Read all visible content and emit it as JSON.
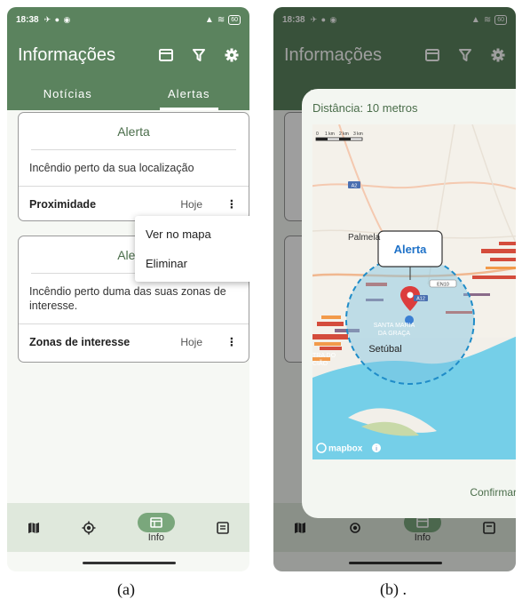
{
  "status": {
    "time": "18:38",
    "battery": "60"
  },
  "app": {
    "title": "Informações",
    "tabs": [
      "Notícias",
      "Alertas"
    ]
  },
  "alerts": [
    {
      "title": "Alerta",
      "body": "Incêndio perto da sua localização",
      "type": "Proximidade",
      "date": "Hoje"
    },
    {
      "title": "Alerta",
      "body": "Incêndio perto duma das suas zonas de interesse.",
      "type": "Zonas de interesse",
      "date": "Hoje"
    }
  ],
  "context_menu": [
    "Ver no mapa",
    "Eliminar"
  ],
  "nav": {
    "info_label": "Info"
  },
  "dialog": {
    "distance": "Distância: 10 metros",
    "confirm": "Confirmar",
    "map": {
      "callout": "Alerta",
      "scale_labels": [
        "0",
        "1 km",
        "2 km",
        "3 km"
      ],
      "road_labels": [
        "A2",
        "EN10",
        "A12"
      ],
      "places": [
        "Palmela",
        "SANTA MARIA",
        "DA GRAÇA",
        "Setúbal",
        "TRA DO",
        "CIÃO"
      ],
      "attribution": "mapbox"
    }
  },
  "captions": [
    "(a)",
    "(b) ."
  ]
}
